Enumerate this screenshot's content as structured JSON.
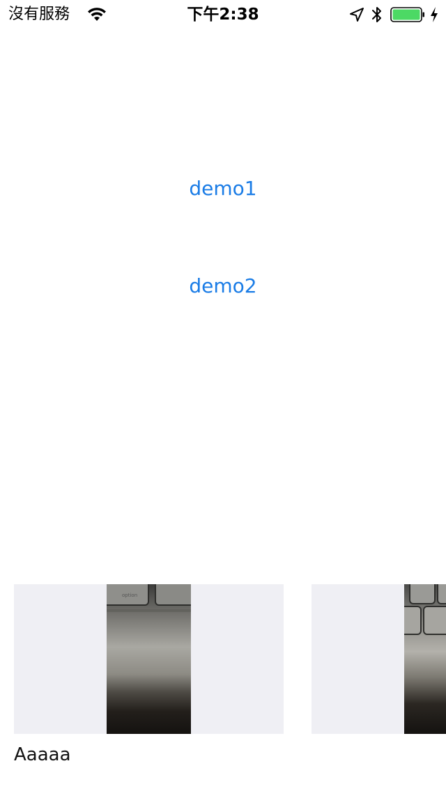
{
  "status_bar": {
    "carrier": "沒有服務",
    "time": "下午2:38",
    "battery_color": "#4cd964",
    "icons": [
      "wifi-icon",
      "location-arrow-icon",
      "bluetooth-icon",
      "battery-icon",
      "charging-bolt-icon"
    ]
  },
  "buttons": {
    "demo1": "demo1",
    "demo2": "demo2",
    "color": "#1a7ce6"
  },
  "carousel": {
    "cards": [
      {
        "caption": "Aaaaa",
        "image": "keyboard-photo"
      },
      {
        "caption": "",
        "image": "keyboard-photo"
      }
    ],
    "card_background": "#efeff4"
  }
}
